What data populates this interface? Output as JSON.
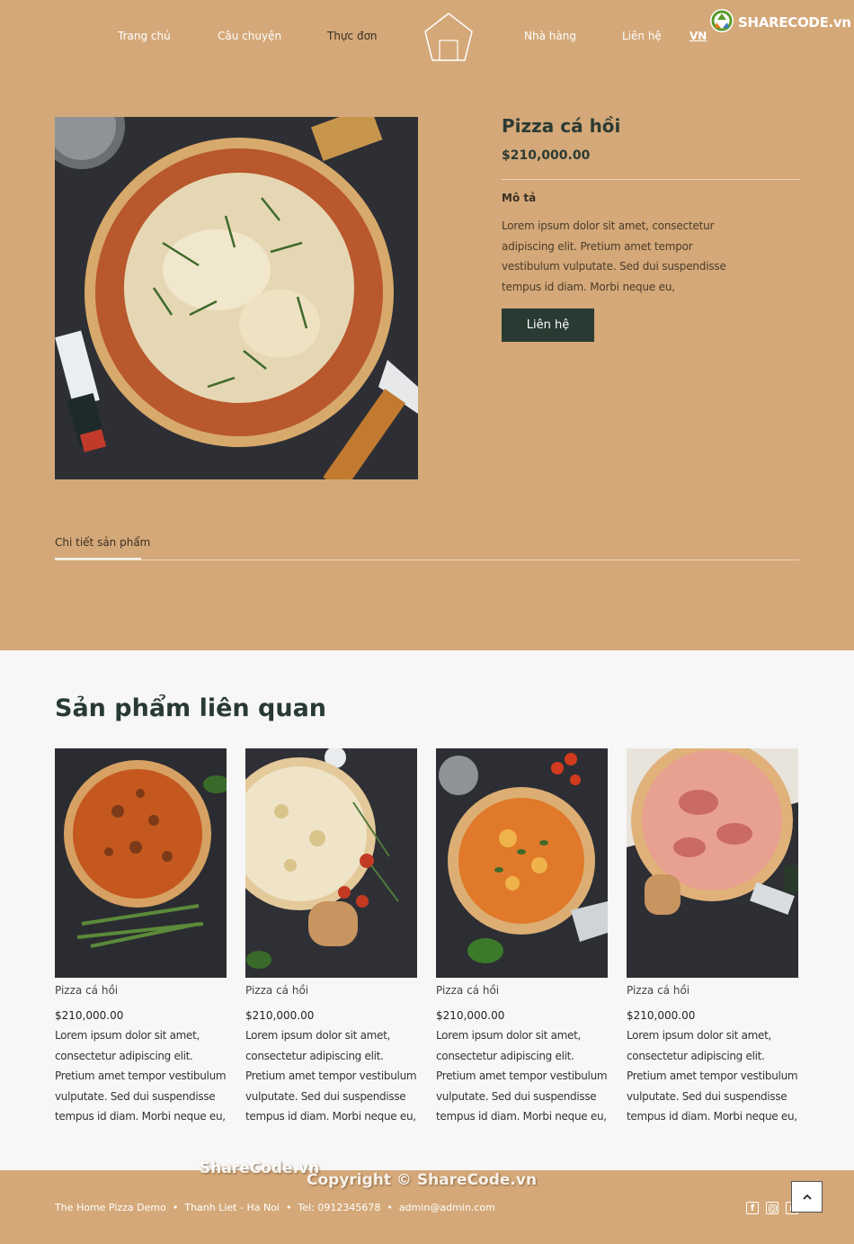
{
  "nav": {
    "items": [
      "Trang chủ",
      "Câu chuyện",
      "Thực đơn",
      "Nhà hàng",
      "Liên hệ"
    ],
    "lang": "VN"
  },
  "brand": {
    "watermark_logo_text": "SHARECODE.vn"
  },
  "product": {
    "title": "Pizza cá hồi",
    "price": "$210,000.00",
    "desc_label": "Mô tả",
    "description": "Lorem ipsum dolor sit amet, consectetur adipiscing elit. Pretium amet tempor vestibulum vulputate. Sed dui suspendisse tempus id diam. Morbi neque eu,",
    "contact_button": "Liên hệ"
  },
  "tabs": {
    "details_label": "Chi tiết sản phẩm"
  },
  "related": {
    "title": "Sản phẩm liên quan",
    "items": [
      {
        "name": "Pizza cá hồi",
        "price": "$210,000.00",
        "description": "Lorem ipsum dolor sit amet, consectetur adipiscing elit. Pretium amet tempor vestibulum vulputate. Sed dui suspendisse tempus id diam. Morbi neque eu,"
      },
      {
        "name": "Pizza cá hồi",
        "price": "$210,000.00",
        "description": "Lorem ipsum dolor sit amet, consectetur adipiscing elit. Pretium amet tempor vestibulum vulputate. Sed dui suspendisse tempus id diam. Morbi neque eu,"
      },
      {
        "name": "Pizza cá hồi",
        "price": "$210,000.00",
        "description": "Lorem ipsum dolor sit amet, consectetur adipiscing elit. Pretium amet tempor vestibulum vulputate. Sed dui suspendisse tempus id diam. Morbi neque eu,"
      },
      {
        "name": "Pizza cá hồi",
        "price": "$210,000.00",
        "description": "Lorem ipsum dolor sit amet, consectetur adipiscing elit. Pretium amet tempor vestibulum vulputate. Sed dui suspendisse tempus id diam. Morbi neque eu,"
      }
    ]
  },
  "footer": {
    "site": "The Home Pizza Demo",
    "address": "Thanh Liet - Ha Noi",
    "phone": "Tel: 0912345678",
    "email": "admin@admin.com",
    "sep": "•",
    "watermark1": "ShareCode.vn",
    "watermark2": "Copyright © ShareCode.vn"
  },
  "icons": [
    "logo-house-icon",
    "sharecode-recycle-icon",
    "facebook-icon",
    "instagram-icon",
    "youtube-icon",
    "chevron-up-icon"
  ],
  "colors": {
    "header_bg": "#d4a878",
    "accent_dark": "#283a31",
    "page_bg": "#f7f7f7"
  }
}
